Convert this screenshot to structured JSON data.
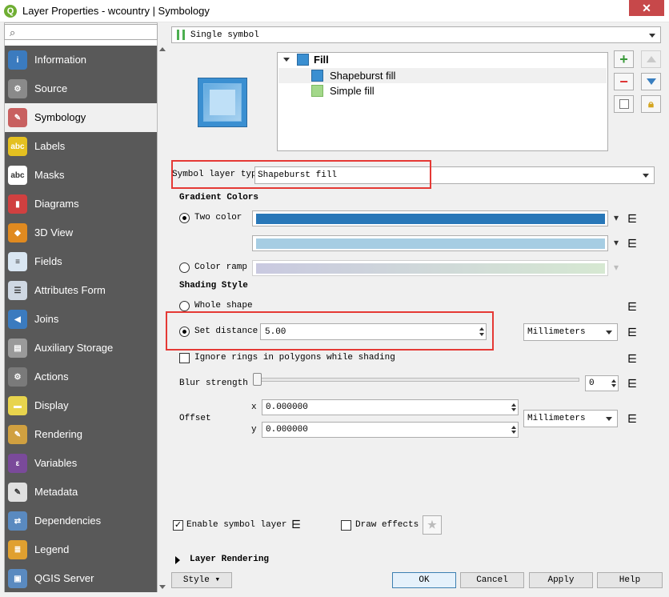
{
  "window": {
    "title": "Layer Properties - wcountry | Symbology",
    "close_symbol": "✕"
  },
  "nav": {
    "items": [
      {
        "label": "Information",
        "icon": "info-icon",
        "color": "#3b7bbf",
        "glyph": "i"
      },
      {
        "label": "Source",
        "icon": "wrench-icon",
        "color": "#8a8a8a",
        "glyph": "⚙"
      },
      {
        "label": "Symbology",
        "icon": "brush-icon",
        "color": "#c86060",
        "glyph": "✎"
      },
      {
        "label": "Labels",
        "icon": "labels-icon",
        "color": "#e4c020",
        "glyph": "abc"
      },
      {
        "label": "Masks",
        "icon": "masks-icon",
        "color": "#ffffff",
        "glyph": "abc"
      },
      {
        "label": "Diagrams",
        "icon": "diagrams-icon",
        "color": "#d04040",
        "glyph": "▮"
      },
      {
        "label": "3D View",
        "icon": "cube-icon",
        "color": "#e08a20",
        "glyph": "◆"
      },
      {
        "label": "Fields",
        "icon": "fields-icon",
        "color": "#d9e6f2",
        "glyph": "≡"
      },
      {
        "label": "Attributes Form",
        "icon": "form-icon",
        "color": "#cfd8e3",
        "glyph": "☰"
      },
      {
        "label": "Joins",
        "icon": "joins-icon",
        "color": "#3b7bbf",
        "glyph": "◀"
      },
      {
        "label": "Auxiliary Storage",
        "icon": "database-icon",
        "color": "#9a9a9a",
        "glyph": "▤"
      },
      {
        "label": "Actions",
        "icon": "actions-icon",
        "color": "#7a7a7a",
        "glyph": "⚙"
      },
      {
        "label": "Display",
        "icon": "display-icon",
        "color": "#e8d44d",
        "glyph": "▬"
      },
      {
        "label": "Rendering",
        "icon": "rendering-icon",
        "color": "#d0a040",
        "glyph": "✎"
      },
      {
        "label": "Variables",
        "icon": "variables-icon",
        "color": "#7a4a9a",
        "glyph": "ε"
      },
      {
        "label": "Metadata",
        "icon": "metadata-icon",
        "color": "#e0e0e0",
        "glyph": "✎"
      },
      {
        "label": "Dependencies",
        "icon": "dependencies-icon",
        "color": "#5a8ac0",
        "glyph": "⇄"
      },
      {
        "label": "Legend",
        "icon": "legend-icon",
        "color": "#e0a030",
        "glyph": "≣"
      },
      {
        "label": "QGIS Server",
        "icon": "server-icon",
        "color": "#5a8ac0",
        "glyph": "▣"
      }
    ],
    "selected_index": 2
  },
  "renderer": {
    "label": "Single symbol"
  },
  "symbol_tree": {
    "root": "Fill",
    "layers": [
      "Shapeburst fill",
      "Simple fill"
    ],
    "selected": 0
  },
  "symbol_layer": {
    "type_label": "Symbol layer type",
    "type_value": "Shapeburst fill"
  },
  "gradient": {
    "section_title": "Gradient Colors",
    "two_color_label": "Two color",
    "color1": "#2877b8",
    "color2": "#a6cde3",
    "color_ramp_label": "Color ramp",
    "ramp_start": "#c9c9e0",
    "ramp_end": "#d6e8d2"
  },
  "shading": {
    "section_title": "Shading Style",
    "whole_shape_label": "Whole shape",
    "set_distance_label": "Set distance",
    "distance_value": "5.00",
    "distance_unit": "Millimeters",
    "ignore_rings_label": "Ignore rings in polygons while shading"
  },
  "blur": {
    "label": "Blur strength",
    "value": "0"
  },
  "offset": {
    "label": "Offset",
    "x_label": "x",
    "y_label": "y",
    "x_value": "0.000000",
    "y_value": "0.000000",
    "unit": "Millimeters"
  },
  "footer": {
    "enable_label": "Enable symbol layer",
    "draw_effects_label": "Draw effects",
    "layer_rendering_label": "Layer Rendering",
    "style_btn": "Style",
    "ok_btn": "OK",
    "cancel_btn": "Cancel",
    "apply_btn": "Apply",
    "help_btn": "Help"
  },
  "colors": {
    "highlight": "#e53935",
    "nav_bg": "#595959",
    "swatch_blue": "#3a8fd1"
  }
}
